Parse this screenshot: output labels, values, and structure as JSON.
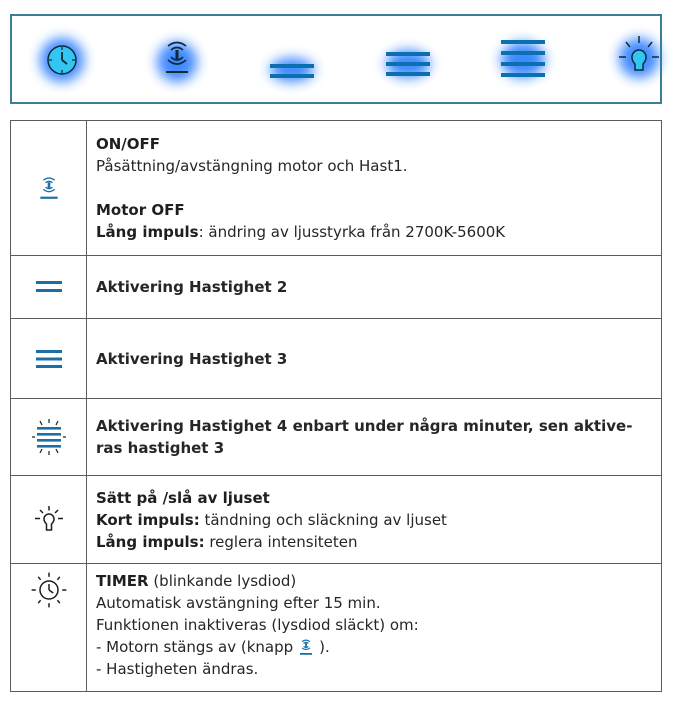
{
  "panel": {
    "buttons": [
      {
        "icon": "timer-icon"
      },
      {
        "icon": "fan-icon"
      },
      {
        "icon": "speed-2-icon"
      },
      {
        "icon": "speed-3-icon"
      },
      {
        "icon": "speed-4-icon"
      },
      {
        "icon": "light-icon"
      }
    ],
    "glow_color": "#2d7fff",
    "line_color": "#0a78b8"
  },
  "rows": {
    "r1": {
      "icon": "fan-icon",
      "title": "ON/OFF",
      "line1": "Påsättning/avstängning motor och Hast1.",
      "title2": "Motor OFF",
      "line2_bold": "Lång impuls",
      "line2_rest": ": ändring av ljusstyrka från 2700K-5600K"
    },
    "r2": {
      "icon": "speed-2-icon",
      "text": "Aktivering Hastighet 2"
    },
    "r3": {
      "icon": "speed-3-icon",
      "text": "Aktivering Hastighet 3"
    },
    "r4": {
      "icon": "speed-4-icon",
      "text": "Aktivering Hastighet 4 enbart under några minuter, sen aktive-ras hastighet 3"
    },
    "r5": {
      "icon": "light-icon",
      "title": "Sätt på /slå av ljuset",
      "l1_bold": "Kort impuls:",
      "l1_rest": " tändning och släckning av ljuset",
      "l2_bold": "Lång impuls:",
      "l2_rest": " reglera intensiteten"
    },
    "r6": {
      "icon": "timer-icon",
      "title": "TIMER",
      "title_rest": " (blinkande lysdiod)",
      "l1": "Automatisk avstängning efter 15 min.",
      "l2": "Funktionen inaktiveras (lysdiod släckt) om:",
      "l3a": "- Motorn stängs av (knapp",
      "l3b": ").",
      "l4": "- Hastigheten ändras."
    }
  }
}
